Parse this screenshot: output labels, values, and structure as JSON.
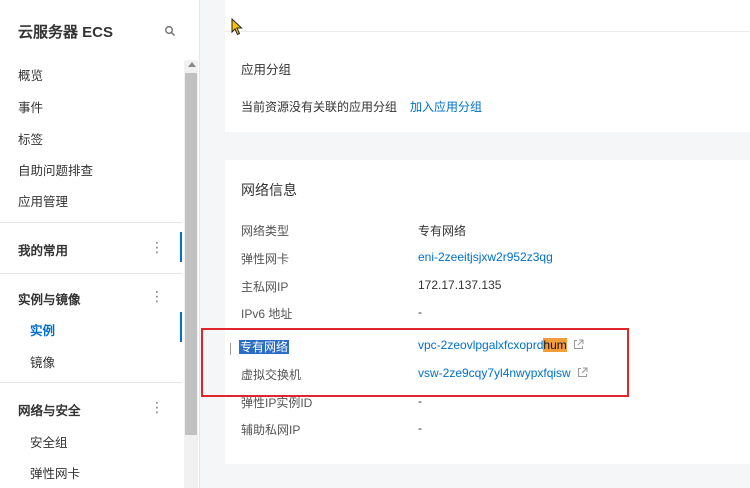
{
  "sidebar": {
    "title": "云服务器 ECS",
    "items": [
      "概览",
      "事件",
      "标签",
      "自助问题排查",
      "应用管理"
    ],
    "favorites_group": "我的常用",
    "group_instances": "实例与镜像",
    "sub_instances": "实例",
    "sub_images": "镜像",
    "group_network": "网络与安全",
    "sub_security_group": "安全组",
    "sub_eni": "弹性网卡",
    "more_glyph": "⋮"
  },
  "app_group": {
    "title": "应用分组",
    "empty_text": "当前资源没有关联的应用分组",
    "add_link": "加入应用分组"
  },
  "network": {
    "title": "网络信息",
    "rows": [
      {
        "label": "网络类型",
        "value": "专有网络"
      },
      {
        "label": "弹性网卡",
        "value": "eni-2zeeitjsjxw2r952z3qg"
      },
      {
        "label": "主私网IP",
        "value": "172.17.137.135"
      },
      {
        "label": "IPv6 地址",
        "value": "-"
      },
      {
        "label": "专有网络",
        "value_prefix": "vpc-2zeovlpgalxfcxoprd",
        "value_highlight": "hum"
      },
      {
        "label": "虚拟交换机",
        "value": "vsw-2ze9cqy7yl4nwypxfqisw"
      },
      {
        "label": "弹性IP实例ID",
        "value": "-"
      },
      {
        "label": "辅助私网IP",
        "value": "-"
      }
    ]
  },
  "colors": {
    "accent": "#0070cc",
    "annotation_box": "#e0262c",
    "find_highlight": "#f39c3a"
  },
  "icons": [
    "search-icon",
    "more-icon",
    "external-link-icon",
    "mouse-cursor-icon",
    "scroll-up-icon"
  ]
}
